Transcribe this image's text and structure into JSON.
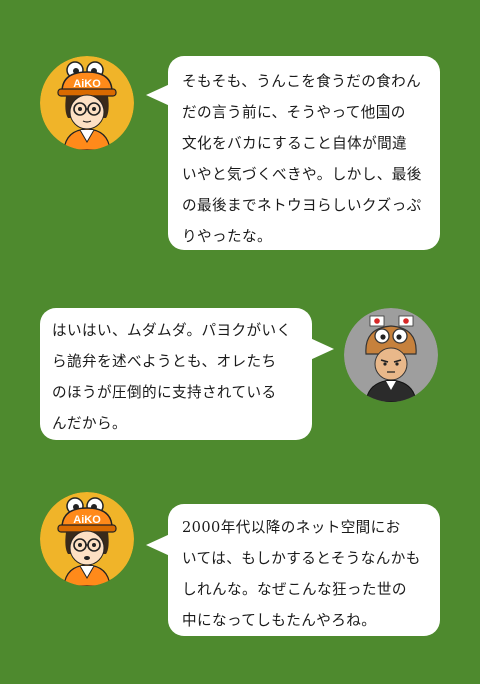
{
  "dialogue": [
    {
      "speaker": "aiko",
      "cap_text": "AiKO",
      "lines": [
        "そもそも、うんこを食うだの食わん",
        "だの言う前に、そうやって他国の",
        "文化をバカにすること自体が間違",
        "いやと気づくべきや。しかし、最後",
        "の最後までネトウヨらしいクズっぷ",
        "りやったな。"
      ]
    },
    {
      "speaker": "netouyo",
      "lines": [
        "はいはい、ムダムダ。パヨクがいく",
        "ら詭弁を述べようとも、オレたち",
        "のほうが圧倒的に支持されている",
        "んだから。"
      ]
    },
    {
      "speaker": "aiko",
      "cap_text": "AiKO",
      "lines": [
        "2000年代以降のネット空間にお",
        "いては、もしかするとそうなんかも",
        "しれんな。なぜこんな狂った世の",
        "中になってしもたんやろね。"
      ]
    }
  ],
  "colors": {
    "background": "#4e8a2e",
    "bubble": "#ffffff",
    "aiko_circle": "#f0b429",
    "netouyo_circle": "#9e9e9e"
  }
}
